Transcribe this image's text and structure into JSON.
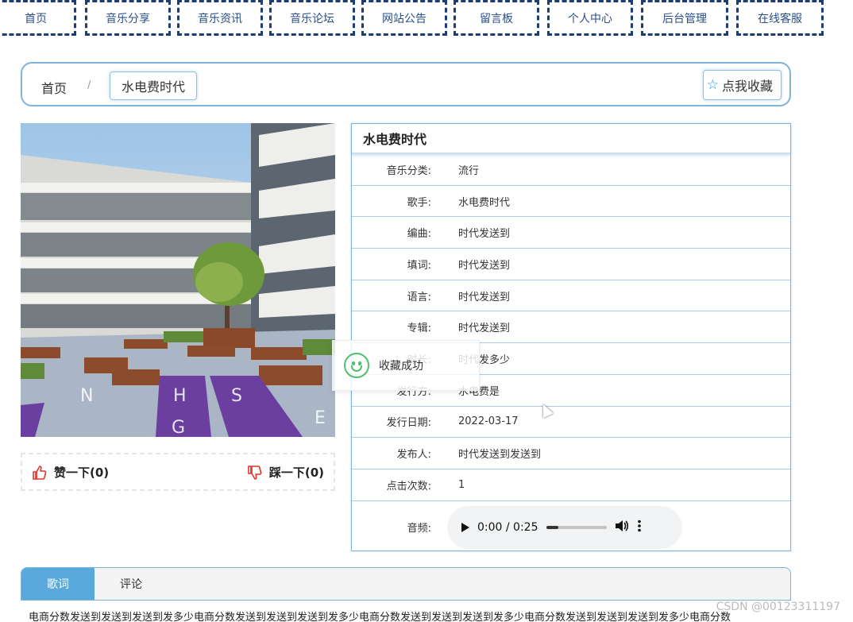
{
  "nav": {
    "items": [
      "首页",
      "音乐分享",
      "音乐资讯",
      "音乐论坛",
      "网站公告",
      "留言板",
      "个人中心",
      "后台管理",
      "在线客服"
    ]
  },
  "breadcrumb": {
    "home": "首页",
    "separator": "/",
    "current": "水电费时代"
  },
  "favorite_button": {
    "label": "点我收藏",
    "icon": "star-outline-icon"
  },
  "detail": {
    "title": "水电费时代",
    "fields": [
      {
        "label": "音乐分类:",
        "value": "流行"
      },
      {
        "label": "歌手:",
        "value": "水电费时代"
      },
      {
        "label": "编曲:",
        "value": "时代发送到"
      },
      {
        "label": "填词:",
        "value": "时代发送到"
      },
      {
        "label": "语言:",
        "value": "时代发送到"
      },
      {
        "label": "专辑:",
        "value": "时代发送到"
      },
      {
        "label": "时长:",
        "value": "时代发多少"
      },
      {
        "label": "发行方:",
        "value": "水电费是"
      },
      {
        "label": "发行日期:",
        "value": "2022-03-17"
      },
      {
        "label": "发布人:",
        "value": "时代发送到发送到"
      },
      {
        "label": "点击次数:",
        "value": "1"
      }
    ],
    "audio_label": "音频:",
    "audio": {
      "time": "0:00 / 0:25",
      "volume_level": 0.2
    }
  },
  "votes": {
    "like_label": "赞一下(0)",
    "dislike_label": "踩一下(0)"
  },
  "toast": {
    "message": "收藏成功"
  },
  "tabs": {
    "items": [
      "歌词",
      "评论"
    ],
    "active": 0
  },
  "lyrics": {
    "text": "电商分数发送到发送到发送到发多少电商分数发送到发送到发送到发多少电商分数发送到发送到发送到发多少电商分数发送到发送到发送到发多少电商分数"
  },
  "watermark": "CSDN @00123311197",
  "colors": {
    "nav_border": "#1b3d73",
    "accent": "#5aa9dc",
    "frame": "#7fb3d9",
    "success": "#4fbf6b",
    "like": "#e0342a"
  }
}
